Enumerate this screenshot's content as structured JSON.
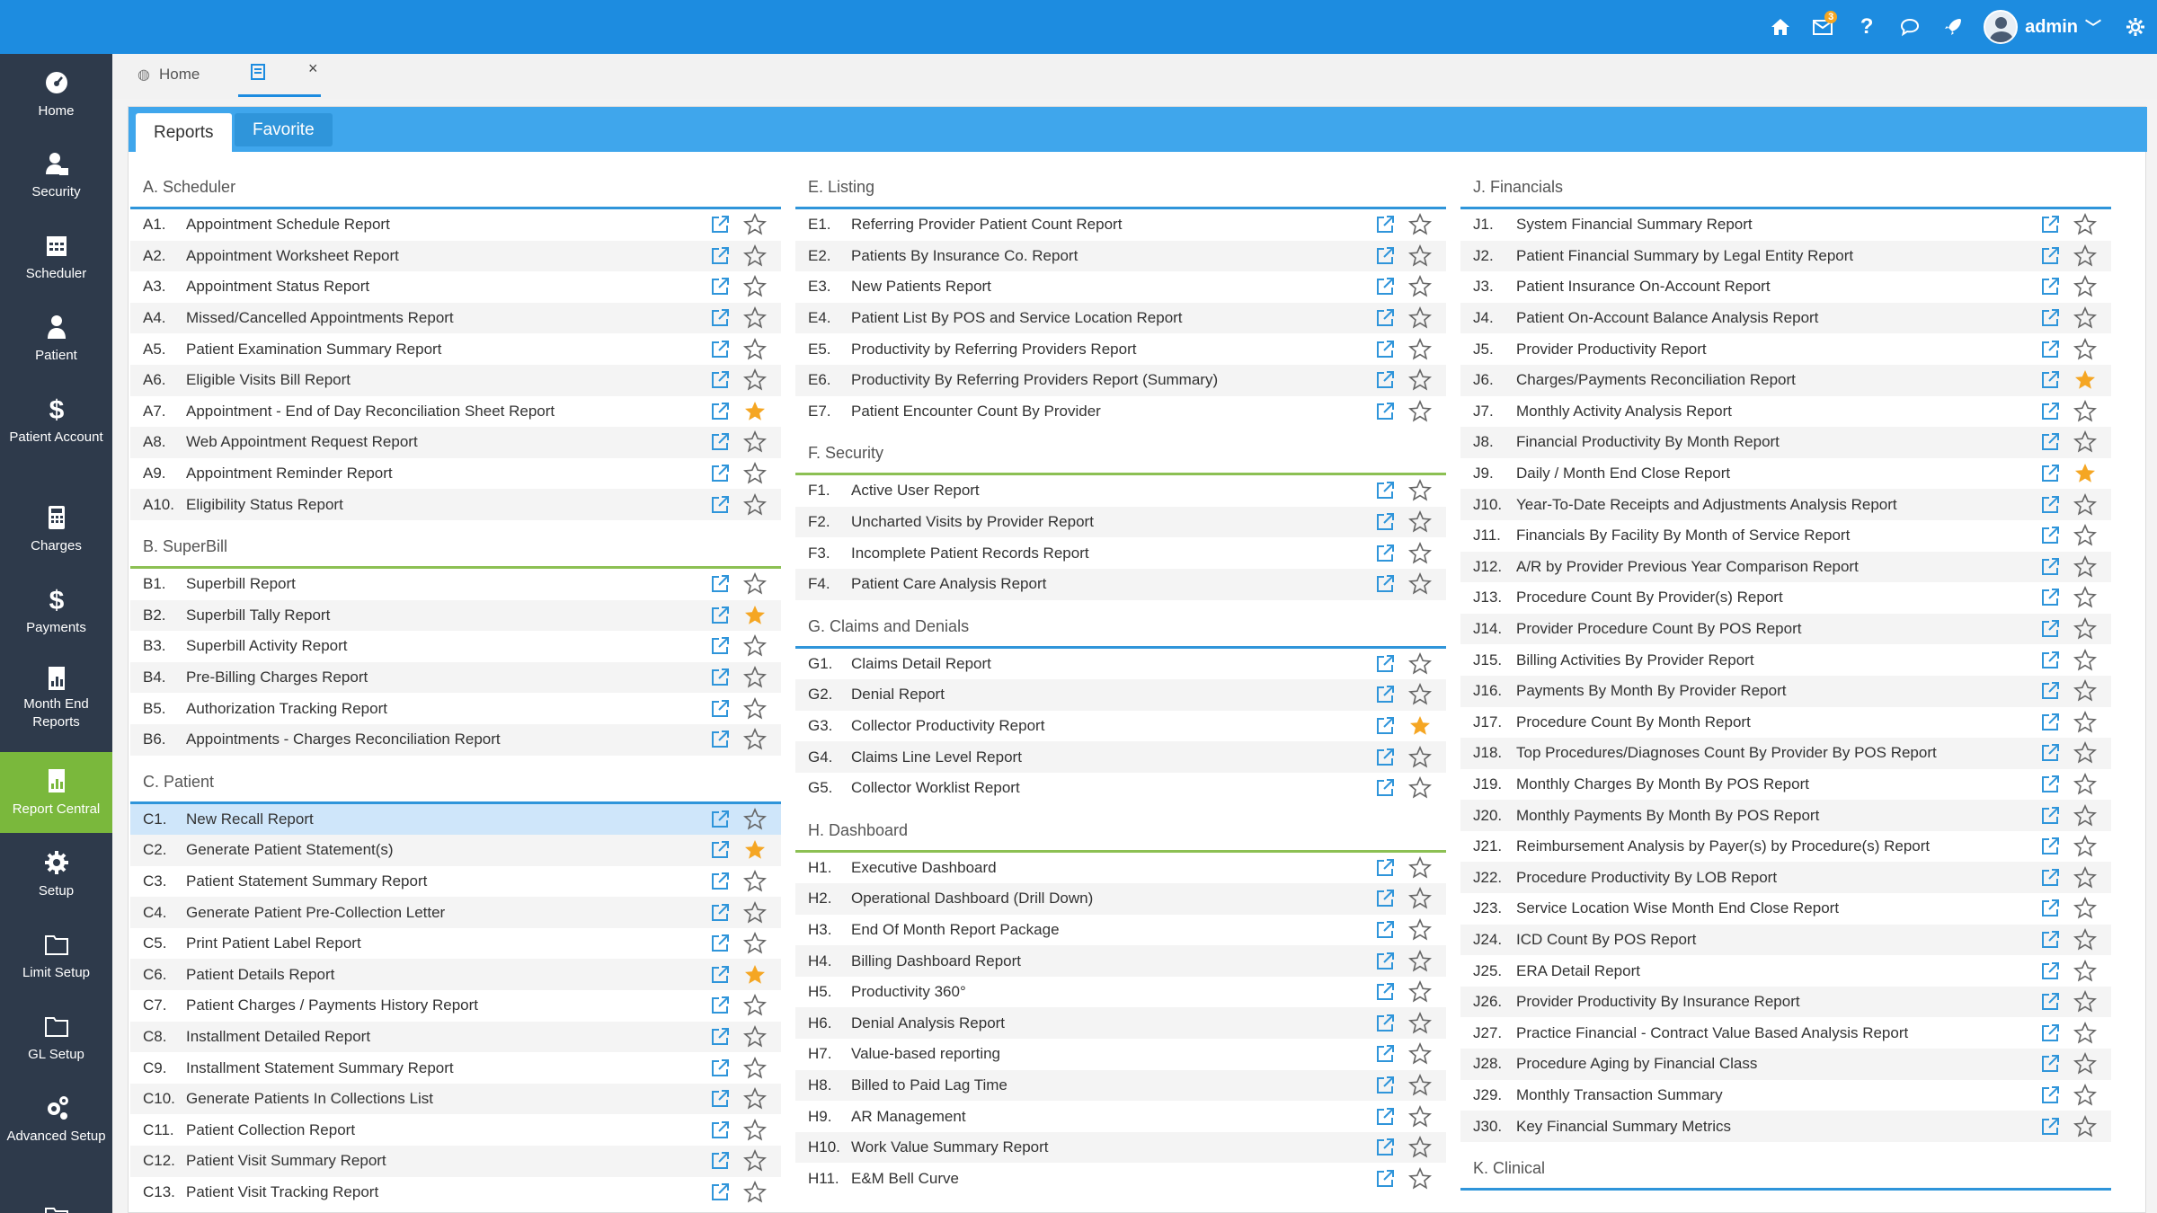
{
  "topbar": {
    "icons": [
      "home-icon",
      "mail-icon",
      "help-icon",
      "chat-icon",
      "rocket-icon",
      "settings-icon"
    ],
    "mail_badge": "3",
    "user_name": "admin"
  },
  "sidebar": {
    "items": [
      {
        "label": "Home",
        "icon": "dashboard-icon"
      },
      {
        "label": "Security",
        "icon": "user-lock-icon"
      },
      {
        "label": "Scheduler",
        "icon": "calendar-icon"
      },
      {
        "label": "Patient",
        "icon": "patient-icon"
      },
      {
        "label": "Patient Account",
        "icon": "dollar-icon"
      },
      {
        "label": "Charges",
        "icon": "calculator-icon"
      },
      {
        "label": "Payments",
        "icon": "dollar-icon"
      },
      {
        "label": "Month End Reports",
        "icon": "report-icon"
      },
      {
        "label": "Report Central",
        "icon": "report-central-icon"
      },
      {
        "label": "Setup",
        "icon": "gear-icon"
      },
      {
        "label": "Limit Setup",
        "icon": "folder-icon"
      },
      {
        "label": "GL Setup",
        "icon": "folder-icon"
      },
      {
        "label": "Advanced Setup",
        "icon": "gears-icon"
      },
      {
        "label": "",
        "icon": "folder-icon"
      }
    ],
    "active": "Report Central"
  },
  "tabs": {
    "home": "Home",
    "close": "×"
  },
  "subtabs": {
    "reports": "Reports",
    "favorite": "Favorite"
  },
  "columns": [
    [
      {
        "title": "A. Scheduler",
        "color": "#2f95da",
        "rows": [
          {
            "code": "A1.",
            "name": "Appointment Schedule Report",
            "fav": false
          },
          {
            "code": "A2.",
            "name": "Appointment Worksheet Report",
            "fav": false
          },
          {
            "code": "A3.",
            "name": "Appointment Status Report",
            "fav": false
          },
          {
            "code": "A4.",
            "name": "Missed/Cancelled Appointments Report",
            "fav": false
          },
          {
            "code": "A5.",
            "name": "Patient Examination Summary Report",
            "fav": false
          },
          {
            "code": "A6.",
            "name": "Eligible Visits Bill Report",
            "fav": false
          },
          {
            "code": "A7.",
            "name": "Appointment - End of Day Reconciliation Sheet Report",
            "fav": true
          },
          {
            "code": "A8.",
            "name": "Web Appointment Request Report",
            "fav": false
          },
          {
            "code": "A9.",
            "name": "Appointment Reminder Report",
            "fav": false
          },
          {
            "code": "A10.",
            "name": "Eligibility Status Report",
            "fav": false
          }
        ]
      },
      {
        "title": "B. SuperBill",
        "color": "#8cc053",
        "rows": [
          {
            "code": "B1.",
            "name": "Superbill Report",
            "fav": false
          },
          {
            "code": "B2.",
            "name": "Superbill Tally Report",
            "fav": true
          },
          {
            "code": "B3.",
            "name": "Superbill Activity Report",
            "fav": false
          },
          {
            "code": "B4.",
            "name": "Pre-Billing Charges Report",
            "fav": false
          },
          {
            "code": "B5.",
            "name": "Authorization Tracking Report",
            "fav": false
          },
          {
            "code": "B6.",
            "name": "Appointments - Charges Reconciliation Report",
            "fav": false
          }
        ]
      },
      {
        "title": "C. Patient",
        "color": "#2f95da",
        "rows": [
          {
            "code": "C1.",
            "name": "New Recall Report",
            "fav": false,
            "selected": true
          },
          {
            "code": "C2.",
            "name": "Generate Patient Statement(s)",
            "fav": true
          },
          {
            "code": "C3.",
            "name": "Patient Statement Summary Report",
            "fav": false
          },
          {
            "code": "C4.",
            "name": "Generate Patient Pre-Collection Letter",
            "fav": false
          },
          {
            "code": "C5.",
            "name": "Print Patient Label Report",
            "fav": false
          },
          {
            "code": "C6.",
            "name": "Patient Details Report",
            "fav": true
          },
          {
            "code": "C7.",
            "name": "Patient Charges / Payments History Report",
            "fav": false
          },
          {
            "code": "C8.",
            "name": "Installment Detailed Report",
            "fav": false
          },
          {
            "code": "C9.",
            "name": "Installment Statement Summary Report",
            "fav": false
          },
          {
            "code": "C10.",
            "name": "Generate Patients In Collections List",
            "fav": false
          },
          {
            "code": "C11.",
            "name": "Patient Collection Report",
            "fav": false
          },
          {
            "code": "C12.",
            "name": "Patient Visit Summary Report",
            "fav": false
          },
          {
            "code": "C13.",
            "name": "Patient Visit Tracking Report",
            "fav": false
          }
        ]
      }
    ],
    [
      {
        "title": "E. Listing",
        "color": "#2f95da",
        "rows": [
          {
            "code": "E1.",
            "name": "Referring Provider Patient Count Report",
            "fav": false
          },
          {
            "code": "E2.",
            "name": "Patients By Insurance Co. Report",
            "fav": false
          },
          {
            "code": "E3.",
            "name": "New Patients Report",
            "fav": false
          },
          {
            "code": "E4.",
            "name": "Patient List By POS and Service Location Report",
            "fav": false
          },
          {
            "code": "E5.",
            "name": "Productivity by Referring Providers Report",
            "fav": false
          },
          {
            "code": "E6.",
            "name": "Productivity By Referring Providers Report (Summary)",
            "fav": false
          },
          {
            "code": "E7.",
            "name": "Patient Encounter Count By Provider",
            "fav": false
          }
        ]
      },
      {
        "title": "F. Security",
        "color": "#8cc053",
        "rows": [
          {
            "code": "F1.",
            "name": "Active User Report",
            "fav": false
          },
          {
            "code": "F2.",
            "name": "Uncharted Visits by Provider Report",
            "fav": false
          },
          {
            "code": "F3.",
            "name": "Incomplete Patient Records Report",
            "fav": false
          },
          {
            "code": "F4.",
            "name": "Patient Care Analysis Report",
            "fav": false
          }
        ]
      },
      {
        "title": "G. Claims and Denials",
        "color": "#2f95da",
        "rows": [
          {
            "code": "G1.",
            "name": "Claims Detail Report",
            "fav": false
          },
          {
            "code": "G2.",
            "name": "Denial Report",
            "fav": false
          },
          {
            "code": "G3.",
            "name": "Collector Productivity Report",
            "fav": true
          },
          {
            "code": "G4.",
            "name": "Claims Line Level Report",
            "fav": false
          },
          {
            "code": "G5.",
            "name": "Collector Worklist Report",
            "fav": false
          }
        ]
      },
      {
        "title": "H. Dashboard",
        "color": "#8cc053",
        "rows": [
          {
            "code": "H1.",
            "name": "Executive Dashboard",
            "fav": false
          },
          {
            "code": "H2.",
            "name": "Operational Dashboard (Drill Down)",
            "fav": false
          },
          {
            "code": "H3.",
            "name": "End Of Month Report Package",
            "fav": false
          },
          {
            "code": "H4.",
            "name": "Billing Dashboard Report",
            "fav": false
          },
          {
            "code": "H5.",
            "name": "Productivity 360°",
            "fav": false
          },
          {
            "code": "H6.",
            "name": "Denial Analysis Report",
            "fav": false
          },
          {
            "code": "H7.",
            "name": "Value-based reporting",
            "fav": false
          },
          {
            "code": "H8.",
            "name": "Billed to Paid Lag Time",
            "fav": false
          },
          {
            "code": "H9.",
            "name": "AR Management",
            "fav": false
          },
          {
            "code": "H10.",
            "name": "Work Value Summary Report",
            "fav": false
          },
          {
            "code": "H11.",
            "name": "E&M Bell Curve",
            "fav": false
          }
        ]
      }
    ],
    [
      {
        "title": "J. Financials",
        "color": "#2f95da",
        "rows": [
          {
            "code": "J1.",
            "name": "System Financial Summary Report",
            "fav": false
          },
          {
            "code": "J2.",
            "name": "Patient Financial Summary by Legal Entity Report",
            "fav": false
          },
          {
            "code": "J3.",
            "name": "Patient Insurance On-Account Report",
            "fav": false
          },
          {
            "code": "J4.",
            "name": "Patient On-Account Balance Analysis Report",
            "fav": false
          },
          {
            "code": "J5.",
            "name": "Provider Productivity Report",
            "fav": false
          },
          {
            "code": "J6.",
            "name": "Charges/Payments Reconciliation Report",
            "fav": true
          },
          {
            "code": "J7.",
            "name": "Monthly Activity Analysis Report",
            "fav": false
          },
          {
            "code": "J8.",
            "name": "Financial Productivity By Month Report",
            "fav": false
          },
          {
            "code": "J9.",
            "name": "Daily / Month End Close Report",
            "fav": true
          },
          {
            "code": "J10.",
            "name": "Year-To-Date Receipts and Adjustments Analysis Report",
            "fav": false
          },
          {
            "code": "J11.",
            "name": "Financials By Facility By Month of Service Report",
            "fav": false
          },
          {
            "code": "J12.",
            "name": "A/R by Provider Previous Year Comparison Report",
            "fav": false
          },
          {
            "code": "J13.",
            "name": "Procedure Count By Provider(s) Report",
            "fav": false
          },
          {
            "code": "J14.",
            "name": "Provider Procedure Count By POS Report",
            "fav": false
          },
          {
            "code": "J15.",
            "name": "Billing Activities By Provider Report",
            "fav": false
          },
          {
            "code": "J16.",
            "name": "Payments By Month By Provider Report",
            "fav": false
          },
          {
            "code": "J17.",
            "name": "Procedure Count By Month Report",
            "fav": false
          },
          {
            "code": "J18.",
            "name": "Top Procedures/Diagnoses Count By Provider By POS Report",
            "fav": false
          },
          {
            "code": "J19.",
            "name": "Monthly Charges By Month By POS Report",
            "fav": false
          },
          {
            "code": "J20.",
            "name": "Monthly Payments By Month By POS Report",
            "fav": false
          },
          {
            "code": "J21.",
            "name": "Reimbursement Analysis by Payer(s) by Procedure(s) Report",
            "fav": false
          },
          {
            "code": "J22.",
            "name": "Procedure Productivity By LOB Report",
            "fav": false
          },
          {
            "code": "J23.",
            "name": "Service Location Wise Month End Close Report",
            "fav": false
          },
          {
            "code": "J24.",
            "name": "ICD Count By POS Report",
            "fav": false
          },
          {
            "code": "J25.",
            "name": "ERA Detail Report",
            "fav": false
          },
          {
            "code": "J26.",
            "name": "Provider Productivity By Insurance Report",
            "fav": false
          },
          {
            "code": "J27.",
            "name": "Practice Financial - Contract Value Based Analysis Report",
            "fav": false
          },
          {
            "code": "J28.",
            "name": "Procedure Aging by Financial Class",
            "fav": false
          },
          {
            "code": "J29.",
            "name": "Monthly Transaction Summary",
            "fav": false
          },
          {
            "code": "J30.",
            "name": "Key Financial Summary Metrics",
            "fav": false
          }
        ]
      },
      {
        "title": "K. Clinical",
        "color": "#2f95da",
        "rows": []
      }
    ]
  ],
  "colors": {
    "topbar": "#1d8ce0",
    "sidebar": "#2e3a4b",
    "sidebar_active": "#7ab83c",
    "star_fav": "#f5a623",
    "open_icon": "#2f95da"
  }
}
